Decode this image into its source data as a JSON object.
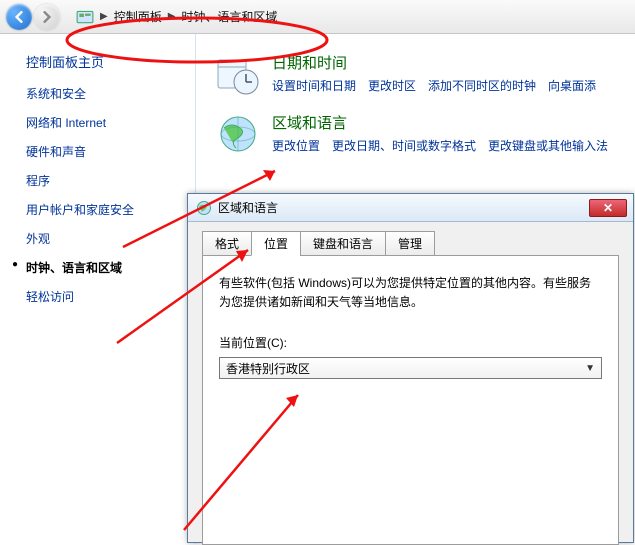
{
  "nav": {
    "crumb_root": "控制面板",
    "crumb_leaf": "时钟、语言和区域"
  },
  "sidebar": {
    "title": "控制面板主页",
    "items": [
      "系统和安全",
      "网络和 Internet",
      "硬件和声音",
      "程序",
      "用户帐户和家庭安全",
      "外观",
      "时钟、语言和区域",
      "轻松访问"
    ],
    "current_index": 6
  },
  "sections": [
    {
      "title": "日期和时间",
      "links": [
        "设置时间和日期",
        "更改时区",
        "添加不同时区的时钟",
        "向桌面添"
      ]
    },
    {
      "title": "区域和语言",
      "links": [
        "更改位置",
        "更改日期、时间或数字格式",
        "更改键盘或其他输入法"
      ]
    }
  ],
  "dialog": {
    "title": "区域和语言",
    "tabs": [
      "格式",
      "位置",
      "键盘和语言",
      "管理"
    ],
    "active_tab": 1,
    "help_text": "有些软件(包括 Windows)可以为您提供特定位置的其他内容。有些服务为您提供诸如新闻和天气等当地信息。",
    "location_label": "当前位置(C):",
    "location_value": "香港特别行政区"
  }
}
